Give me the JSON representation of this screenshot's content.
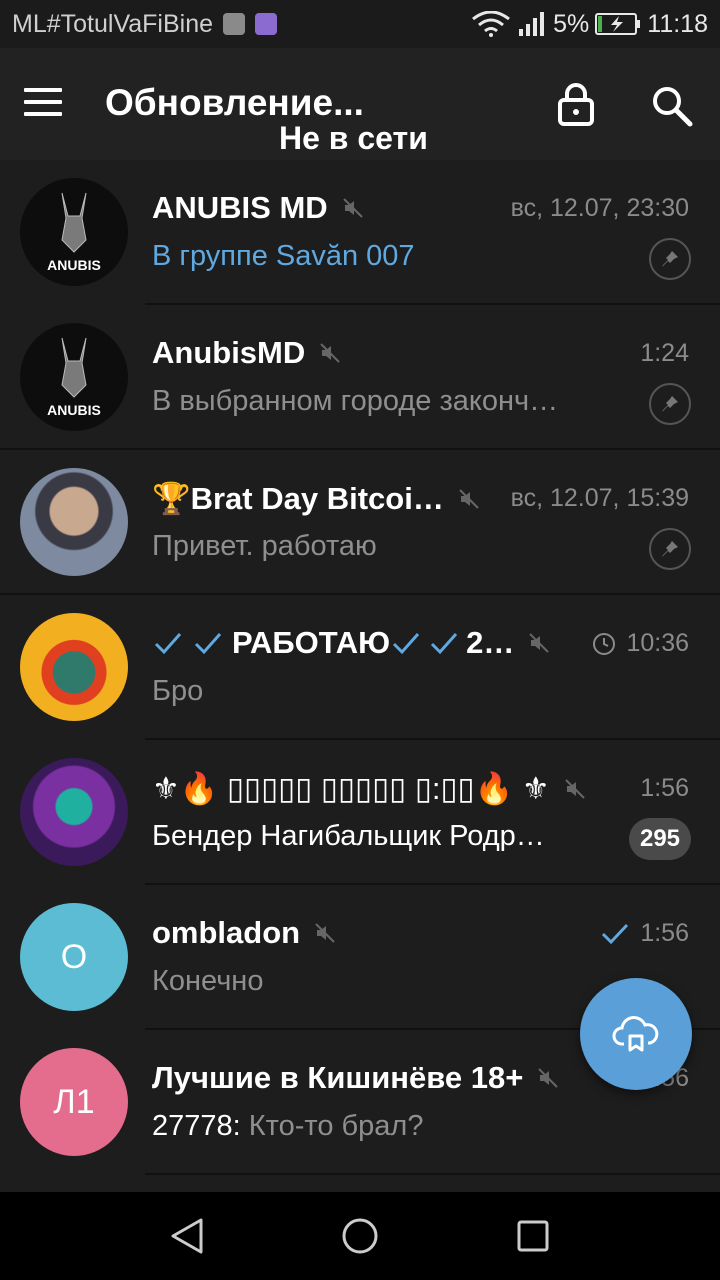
{
  "status_bar": {
    "carrier": "ML#TotulVaFiBine",
    "battery_percent": "5%",
    "time": "11:18"
  },
  "app_bar": {
    "title": "Обновление...",
    "subtitle": "Не в сети",
    "icons": [
      "menu-icon",
      "lock-icon",
      "search-icon"
    ]
  },
  "chats": [
    {
      "name": "ANUBIS MD",
      "time": "вс, 12.07, 23:30",
      "message": "В группе Savăn 007",
      "muted": true,
      "pinned": true,
      "avatar_text": "ANUBIS",
      "avatar_bg": "#0d0d0d"
    },
    {
      "name": "AnubisMD",
      "time": "1:24",
      "message": "В выбранном городе законч…",
      "muted": true,
      "pinned": true,
      "avatar_text": "ANUBIS",
      "avatar_bg": "#0d0d0d"
    },
    {
      "name": "🏆Brat Day Bitcoi…",
      "time": "вс, 12.07, 15:39",
      "message": "Привет. работаю",
      "muted": true,
      "pinned": true,
      "avatar_bg": "#6a7890"
    },
    {
      "name": "РАБОТАЮ",
      "name_suffix": "2…",
      "time": "10:36",
      "message": "Бро",
      "muted": true,
      "pinned": false,
      "scheduled": true,
      "avatar_bg": "#f0a020"
    },
    {
      "name": "⚜🔥 ▯▯▯▯▯ ▯▯▯▯▯ ▯:▯▯🔥 ⚜",
      "time": "1:56",
      "message": "Бендер Нагибальщик Родр…",
      "muted": true,
      "pinned": false,
      "badge": "295",
      "avatar_bg": "#6a2a8a"
    },
    {
      "name": "ombladon",
      "time": "1:56",
      "message": "Конечно",
      "muted": true,
      "pinned": false,
      "read": true,
      "avatar_text": "O",
      "avatar_bg": "#5bbcd3"
    },
    {
      "name": "Лучшие в Кишинёве 18+",
      "time": "1:56",
      "message_sender": "27778:",
      "message": "Кто-то брал?",
      "muted": true,
      "pinned": false,
      "avatar_text": "Л1",
      "avatar_bg": "#e46c8c"
    }
  ],
  "fab": {
    "icon": "cloud-upload-icon"
  },
  "colors": {
    "accent": "#5a9fd8",
    "background": "#1d1d1d",
    "link": "#5fa9e0"
  }
}
